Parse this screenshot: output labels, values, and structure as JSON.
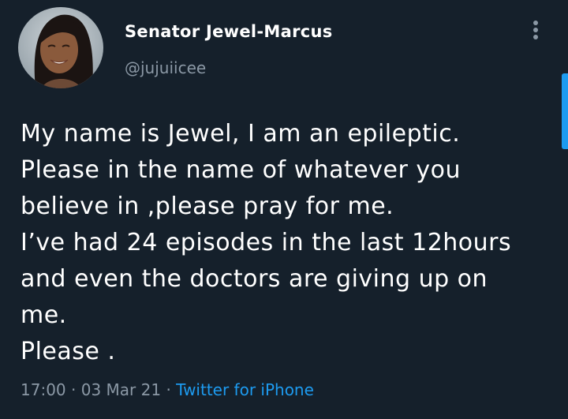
{
  "author": {
    "display_name": "Senator Jewel-Marcus",
    "handle": "@jujuiicee"
  },
  "tweet": {
    "lines": [
      "My name is Jewel, I am an epileptic.",
      "Please in the name of whatever you",
      "believe in ,please pray for me.",
      "I’ve had 24 episodes in the last 12hours",
      "and even the doctors are giving up on",
      "me.",
      "Please ."
    ],
    "time": "17:00",
    "date": "03 Mar 21",
    "separator": "·",
    "source": "Twitter for iPhone"
  },
  "colors": {
    "background": "#15202b",
    "text": "#ffffff",
    "secondary": "#8b98a5",
    "accent": "#1d9bf0"
  },
  "icons": {
    "more": "more-vertical-icon"
  }
}
